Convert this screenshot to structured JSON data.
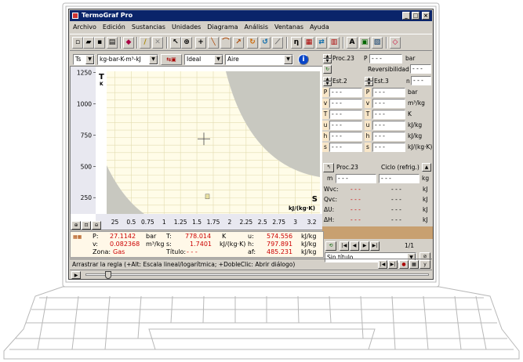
{
  "window": {
    "title": "TermoGraf Pro"
  },
  "menu": [
    "Archivo",
    "Edición",
    "Sustancias",
    "Unidades",
    "Diagrama",
    "Análisis",
    "Ventanas",
    "Ayuda"
  ],
  "toolbar": {
    "diagram_type": "Ts",
    "units": "kg-bar-K-m³-kJ",
    "model": "Ideal",
    "substance": "Aire"
  },
  "chart_data": {
    "type": "line",
    "ylabel": "T",
    "ylabel_unit": "K",
    "xlabel": "S",
    "xlabel_unit": "kJ/(kg·K)",
    "y_ticks": [
      250,
      500,
      750,
      1000,
      1250
    ],
    "x_ticks": [
      "25",
      "0.5",
      "0.75",
      "1",
      "1.25",
      "1.5",
      "1.75",
      "2",
      "2.25",
      "2.5",
      "2.75",
      "3",
      "3.2"
    ],
    "ylim": [
      120,
      1260
    ],
    "xlim": [
      0.15,
      3.25
    ]
  },
  "process_panel": {
    "proc_label": "Proc.23",
    "p_label": "P",
    "p_value": "- - -",
    "p_unit": "bar",
    "reversibility_label": "Reversibilidad",
    "reversibility_value": "- - -",
    "state_a": "Est.2",
    "state_b": "Est.3",
    "n_label": "n",
    "n_value": "- - -",
    "props": [
      {
        "sym": "P",
        "a": "- - -",
        "b": "- - -",
        "unit": "bar"
      },
      {
        "sym": "v",
        "a": "- - -",
        "b": "- - -",
        "unit": "m³/kg"
      },
      {
        "sym": "T",
        "a": "- - -",
        "b": "- - -",
        "unit": "K"
      },
      {
        "sym": "u",
        "a": "- - -",
        "b": "- - -",
        "unit": "kJ/kg"
      },
      {
        "sym": "h",
        "a": "- - -",
        "b": "- - -",
        "unit": "kJ/kg"
      },
      {
        "sym": "s",
        "a": "- - -",
        "b": "- - -",
        "unit": "kJ/(kg·K)"
      }
    ],
    "cycle_proc": "Proc.23",
    "cycle_label": "Ciclo (refrig.)",
    "m_label": "m",
    "m_a": "- - -",
    "m_b": "- - -",
    "m_unit": "kg",
    "energies": [
      {
        "sym": "Wvc:",
        "a": "- - -",
        "b": "- - -",
        "unit": "kJ"
      },
      {
        "sym": "Qvc:",
        "a": "- - -",
        "b": "- - -",
        "unit": "kJ"
      },
      {
        "sym": "ΔU:",
        "a": "- - -",
        "b": "- - -",
        "unit": "kJ"
      },
      {
        "sym": "ΔH:",
        "a": "- - -",
        "b": "- - -",
        "unit": "kJ"
      }
    ],
    "page": "1/1",
    "selection": "Sin título"
  },
  "state_info": {
    "P": "27.1142",
    "P_unit": "bar",
    "v": "0.082368",
    "v_unit": "m³/kg",
    "zone_label": "Zona:",
    "zone": "Gas",
    "T": "778.014",
    "T_unit": "K",
    "s": "1.7401",
    "s_unit": "kJ/(kg·K)",
    "title_label": "Título:",
    "title": "- - -",
    "u": "574.556",
    "u_unit": "kJ/kg",
    "h": "797.891",
    "h_unit": "kJ/kg",
    "af": "485.231",
    "af_unit": "kJ/kg"
  },
  "status": "Arrastrar la regla (+Alt: Escala lineal/logarítmica; +DobleClic: Abrir diálogo)"
}
